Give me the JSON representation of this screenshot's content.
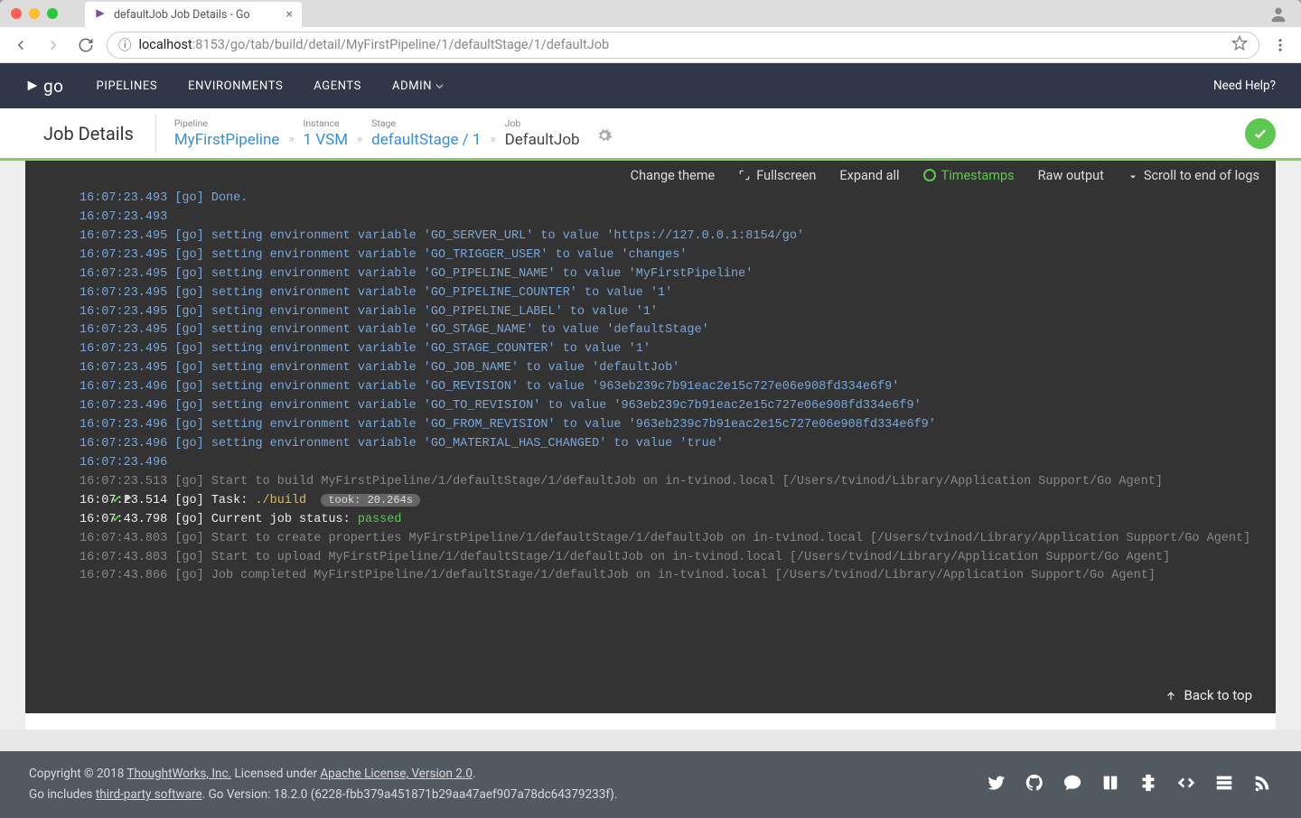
{
  "browser": {
    "tab_title": "defaultJob Job Details - Go",
    "url_proto_info": "ⓘ",
    "url_host": "localhost",
    "url_port_path": ":8153/go/tab/build/detail/MyFirstPipeline/1/defaultStage/1/defaultJob"
  },
  "header": {
    "logo_text": "go",
    "nav": [
      "PIPELINES",
      "ENVIRONMENTS",
      "AGENTS",
      "ADMIN"
    ],
    "help": "Need Help?"
  },
  "jobbar": {
    "title": "Job Details",
    "segments": [
      {
        "label": "Pipeline",
        "value": "MyFirstPipeline",
        "link": true
      },
      {
        "label": "Instance",
        "value": "1 VSM",
        "link": true
      },
      {
        "label": "Stage",
        "value": "defaultStage / 1",
        "link": true
      },
      {
        "label": "Job",
        "value": "DefaultJob",
        "link": false
      }
    ]
  },
  "console_toolbar": {
    "change_theme": "Change theme",
    "fullscreen": "Fullscreen",
    "expand_all": "Expand all",
    "timestamps": "Timestamps",
    "raw_output": "Raw output",
    "scroll_end": "Scroll to end of logs"
  },
  "console": {
    "lines": [
      {
        "ts": "16:07:23.493",
        "tag": "[go]",
        "txt": "Done.",
        "cls": "blue"
      },
      {
        "ts": "16:07:23.493",
        "tag": "",
        "txt": "",
        "cls": "blue"
      },
      {
        "ts": "16:07:23.495",
        "tag": "[go]",
        "txt": "setting environment variable 'GO_SERVER_URL' to value 'https://127.0.0.1:8154/go'",
        "cls": "blue"
      },
      {
        "ts": "16:07:23.495",
        "tag": "[go]",
        "txt": "setting environment variable 'GO_TRIGGER_USER' to value 'changes'",
        "cls": "blue"
      },
      {
        "ts": "16:07:23.495",
        "tag": "[go]",
        "txt": "setting environment variable 'GO_PIPELINE_NAME' to value 'MyFirstPipeline'",
        "cls": "blue"
      },
      {
        "ts": "16:07:23.495",
        "tag": "[go]",
        "txt": "setting environment variable 'GO_PIPELINE_COUNTER' to value '1'",
        "cls": "blue"
      },
      {
        "ts": "16:07:23.495",
        "tag": "[go]",
        "txt": "setting environment variable 'GO_PIPELINE_LABEL' to value '1'",
        "cls": "blue"
      },
      {
        "ts": "16:07:23.495",
        "tag": "[go]",
        "txt": "setting environment variable 'GO_STAGE_NAME' to value 'defaultStage'",
        "cls": "blue"
      },
      {
        "ts": "16:07:23.495",
        "tag": "[go]",
        "txt": "setting environment variable 'GO_STAGE_COUNTER' to value '1'",
        "cls": "blue"
      },
      {
        "ts": "16:07:23.495",
        "tag": "[go]",
        "txt": "setting environment variable 'GO_JOB_NAME' to value 'defaultJob'",
        "cls": "blue"
      },
      {
        "ts": "16:07:23.496",
        "tag": "[go]",
        "txt": "setting environment variable 'GO_REVISION' to value '963eb239c7b91eac2e15c727e06e908fd334e6f9'",
        "cls": "blue"
      },
      {
        "ts": "16:07:23.496",
        "tag": "[go]",
        "txt": "setting environment variable 'GO_TO_REVISION' to value '963eb239c7b91eac2e15c727e06e908fd334e6f9'",
        "cls": "blue"
      },
      {
        "ts": "16:07:23.496",
        "tag": "[go]",
        "txt": "setting environment variable 'GO_FROM_REVISION' to value '963eb239c7b91eac2e15c727e06e908fd334e6f9'",
        "cls": "blue"
      },
      {
        "ts": "16:07:23.496",
        "tag": "[go]",
        "txt": "setting environment variable 'GO_MATERIAL_HAS_CHANGED' to value 'true'",
        "cls": "blue"
      },
      {
        "ts": "16:07:23.496",
        "tag": "",
        "txt": "",
        "cls": "blue"
      },
      {
        "ts": "16:07:23.513",
        "tag": "[go]",
        "txt": "Start to build MyFirstPipeline/1/defaultStage/1/defaultJob on in-tvinod.local [/Users/tvinod/Library/Application Support/Go Agent]",
        "cls": "dim"
      }
    ],
    "task_line": {
      "ts": "16:07:23.514",
      "tag": "[go]",
      "prefix": "Task: ",
      "cmd": "./build",
      "took": "took: 20.264s"
    },
    "status_line": {
      "ts": "16:07:43.798",
      "tag": "[go]",
      "prefix": "Current job status: ",
      "status": "passed"
    },
    "tail": [
      {
        "ts": "16:07:43.803",
        "tag": "[go]",
        "txt": "Start to create properties MyFirstPipeline/1/defaultStage/1/defaultJob on in-tvinod.local [/Users/tvinod/Library/Application Support/Go Agent]"
      },
      {
        "ts": "16:07:43.803",
        "tag": "[go]",
        "txt": "Start to upload MyFirstPipeline/1/defaultStage/1/defaultJob on in-tvinod.local [/Users/tvinod/Library/Application Support/Go Agent]"
      },
      {
        "ts": "16:07:43.866",
        "tag": "[go]",
        "txt": "Job completed MyFirstPipeline/1/defaultStage/1/defaultJob on in-tvinod.local [/Users/tvinod/Library/Application Support/Go Agent]"
      }
    ],
    "back_to_top": "Back to top"
  },
  "footer": {
    "line1_a": "Copyright © 2018 ",
    "line1_b": "ThoughtWorks, Inc.",
    "line1_c": " Licensed under ",
    "line1_d": "Apache License, Version 2.0",
    "line1_e": ".",
    "line2_a": "Go includes ",
    "line2_b": "third-party software",
    "line2_c": ". Go Version: 18.2.0 (6228-fbb379a451871b29aa47aef907a78dc64379233f)."
  }
}
